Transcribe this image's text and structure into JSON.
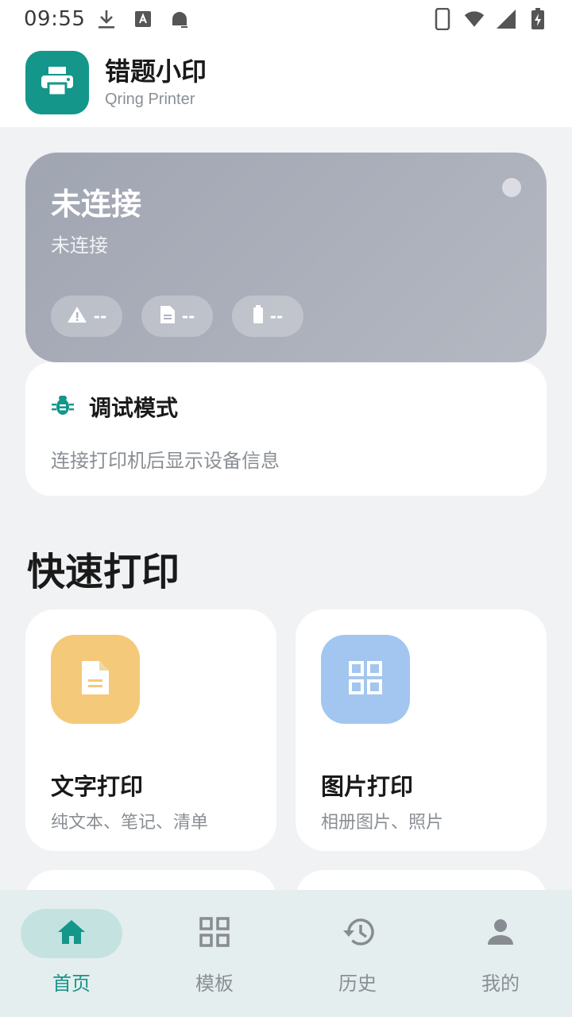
{
  "status_bar": {
    "time": "09:55",
    "left_icons": [
      "download-icon",
      "a-keyboard-icon",
      "android-icon"
    ],
    "right_icons": [
      "phone-icon",
      "wifi-icon",
      "signal-icon",
      "battery-charging-icon"
    ]
  },
  "app": {
    "title": "错题小印",
    "subtitle": "Qring Printer",
    "logo_icon": "printer-icon",
    "accent_color": "#14968a"
  },
  "connection": {
    "title": "未连接",
    "subtitle": "未连接",
    "pills": [
      {
        "icon": "warning-icon",
        "value": "--"
      },
      {
        "icon": "document-icon",
        "value": "--"
      },
      {
        "icon": "battery-icon",
        "value": "--"
      }
    ]
  },
  "debug": {
    "icon": "bug-icon",
    "title": "调试模式",
    "info": "连接打印机后显示设备信息"
  },
  "quick_print": {
    "section_title": "快速打印",
    "items": [
      {
        "title": "文字打印",
        "desc": "纯文本、笔记、清单",
        "icon": "document-icon",
        "color": "#f5c97a"
      },
      {
        "title": "图片打印",
        "desc": "相册图片、照片",
        "icon": "grid-icon",
        "color": "#a2c6ef"
      }
    ]
  },
  "bottom_nav": {
    "items": [
      {
        "label": "首页",
        "icon": "home-icon",
        "active": true
      },
      {
        "label": "模板",
        "icon": "grid-icon",
        "active": false
      },
      {
        "label": "历史",
        "icon": "history-icon",
        "active": false
      },
      {
        "label": "我的",
        "icon": "person-icon",
        "active": false
      }
    ]
  }
}
